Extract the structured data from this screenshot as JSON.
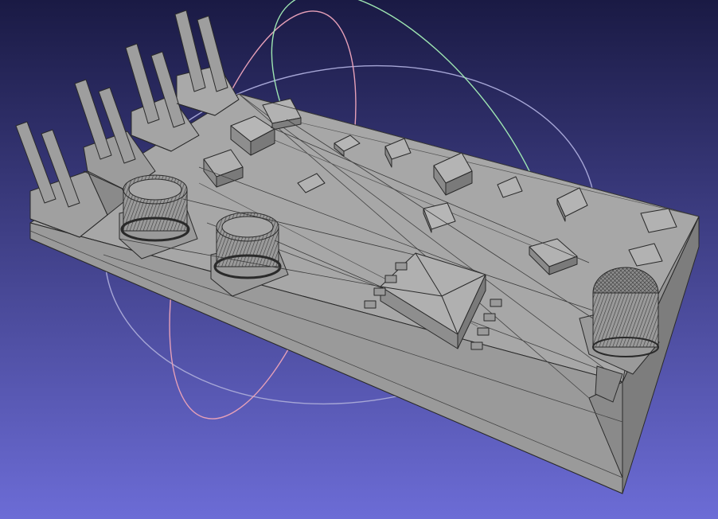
{
  "viewport": {
    "background_top": "#1c1c48",
    "background_bottom": "#6e6ed8",
    "mesh_face": "#a3a3a3",
    "mesh_face_light": "#b8b8b8",
    "mesh_face_dark": "#7c7c7c",
    "mesh_edge": "#2e2e2e",
    "trackball_x_color": "#e8a0b8",
    "trackball_y_color": "#9ce8b4",
    "trackball_z_color": "#a8a8d8"
  },
  "model": {
    "icon": "3d-mesh-pcb-model",
    "parts": [
      "pin-header-row",
      "rotary-potentiometer",
      "rotary-potentiometer",
      "smd-ic-package",
      "push-button-knob",
      "smd-components"
    ]
  }
}
